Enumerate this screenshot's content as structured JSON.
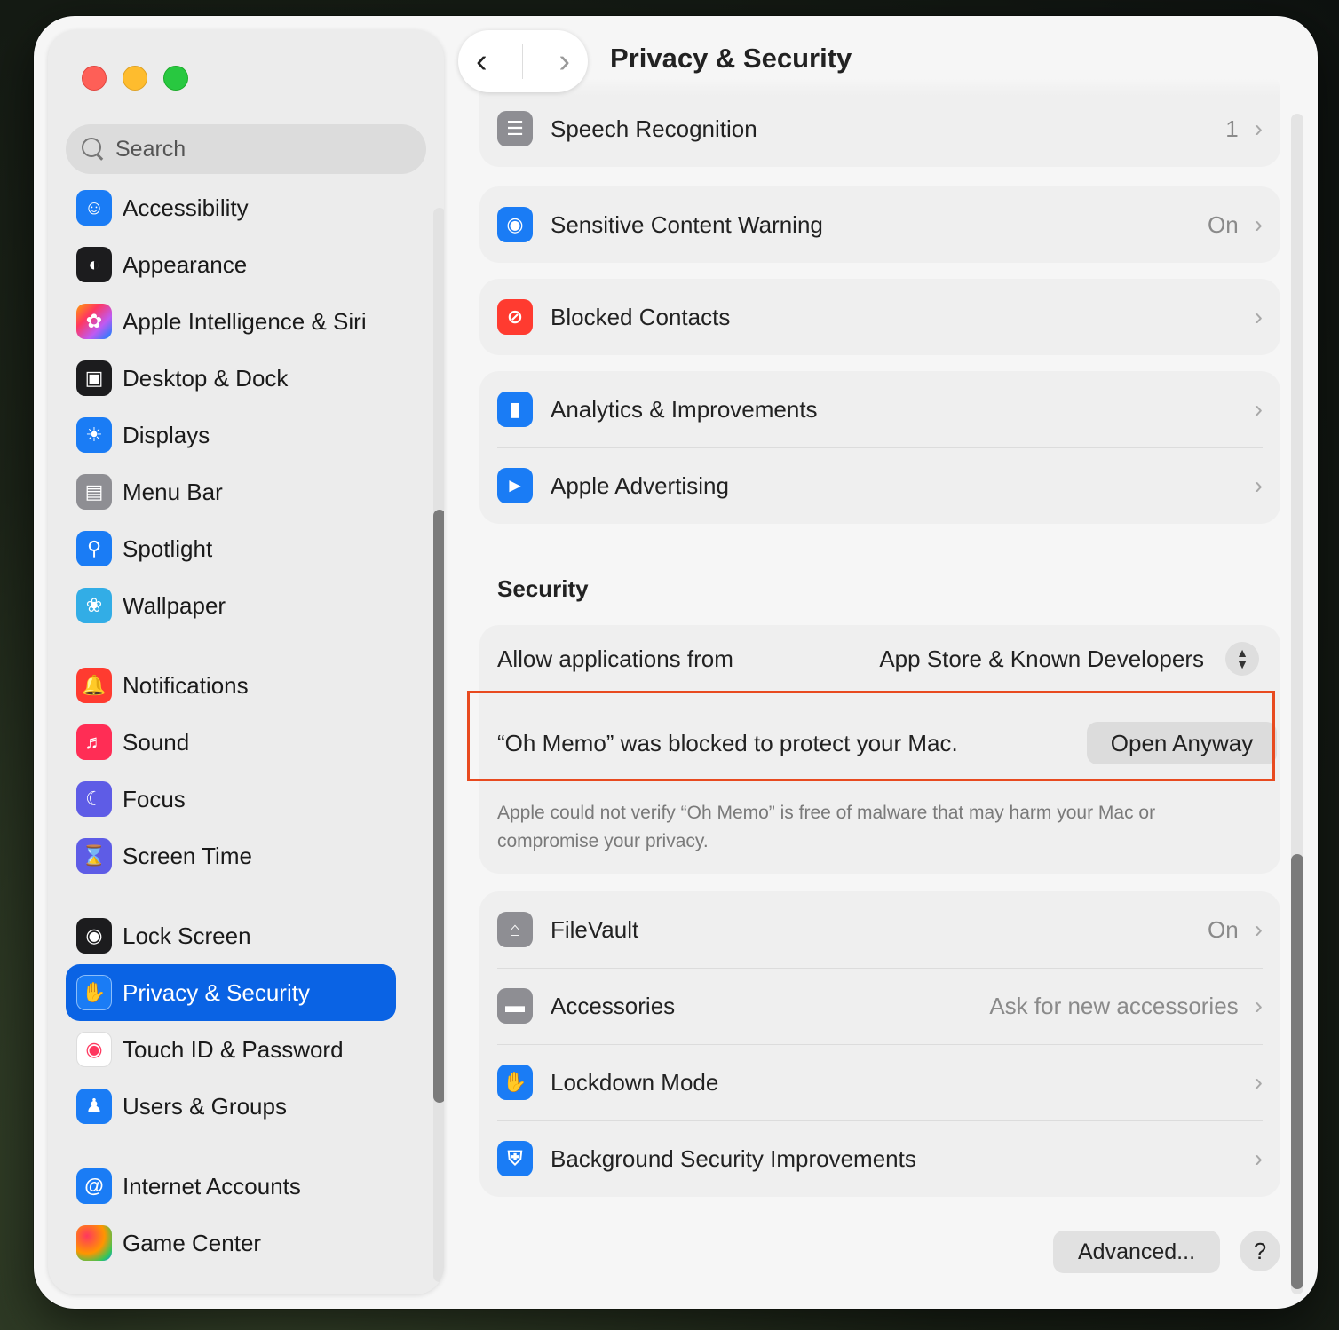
{
  "window": {
    "title": "Privacy & Security"
  },
  "search": {
    "placeholder": "Search"
  },
  "sidebar": {
    "items": [
      {
        "label": "Accessibility",
        "icon": "accessibility-icon",
        "color": "#1a7cf5"
      },
      {
        "label": "Appearance",
        "icon": "appearance-icon",
        "color": "#1c1c1e"
      },
      {
        "label": "Apple Intelligence & Siri",
        "icon": "siri-icon",
        "color": "#c77dff"
      },
      {
        "label": "Desktop & Dock",
        "icon": "dock-icon",
        "color": "#1c1c1e"
      },
      {
        "label": "Displays",
        "icon": "sun-icon",
        "color": "#1a7cf5"
      },
      {
        "label": "Menu Bar",
        "icon": "menubar-icon",
        "color": "#8e8e93"
      },
      {
        "label": "Spotlight",
        "icon": "magnifier-icon",
        "color": "#1a7cf5"
      },
      {
        "label": "Wallpaper",
        "icon": "flower-icon",
        "color": "#32ade6"
      },
      {
        "label": "Notifications",
        "icon": "bell-icon",
        "color": "#ff3b30"
      },
      {
        "label": "Sound",
        "icon": "speaker-icon",
        "color": "#ff2d55"
      },
      {
        "label": "Focus",
        "icon": "moon-icon",
        "color": "#5e5ce6"
      },
      {
        "label": "Screen Time",
        "icon": "hourglass-icon",
        "color": "#5e5ce6"
      },
      {
        "label": "Lock Screen",
        "icon": "lock-icon",
        "color": "#1c1c1e"
      },
      {
        "label": "Privacy & Security",
        "icon": "hand-icon",
        "color": "#1a7cf5"
      },
      {
        "label": "Touch ID & Password",
        "icon": "fingerprint-icon",
        "color": "#ffffff"
      },
      {
        "label": "Users & Groups",
        "icon": "users-icon",
        "color": "#1a7cf5"
      },
      {
        "label": "Internet Accounts",
        "icon": "at-icon",
        "color": "#1a7cf5"
      },
      {
        "label": "Game Center",
        "icon": "gamecenter-icon",
        "color": "#ff9500"
      }
    ],
    "active": "Privacy & Security"
  },
  "privacy": {
    "speech": {
      "label": "Speech Recognition",
      "value": "1"
    },
    "sensitive": {
      "label": "Sensitive Content Warning",
      "value": "On"
    },
    "blocked_contacts": {
      "label": "Blocked Contacts"
    },
    "analytics": {
      "label": "Analytics & Improvements"
    },
    "advertising": {
      "label": "Apple Advertising"
    }
  },
  "security": {
    "title": "Security",
    "allow_label": "Allow applications from",
    "allow_value": "App Store & Known Developers",
    "blocked_message": "“Oh Memo” was blocked to protect your Mac.",
    "open_anyway": "Open Anyway",
    "note": "Apple could not verify “Oh Memo” is free of malware that may harm your Mac or compromise your privacy.",
    "filevault": {
      "label": "FileVault",
      "value": "On"
    },
    "accessories": {
      "label": "Accessories",
      "value": "Ask for new accessories"
    },
    "lockdown": {
      "label": "Lockdown Mode"
    },
    "background": {
      "label": "Background Security Improvements"
    }
  },
  "footer": {
    "advanced": "Advanced...",
    "help": "?"
  },
  "colors": {
    "accent": "#0a63e4",
    "highlight": "#e84a1f"
  }
}
